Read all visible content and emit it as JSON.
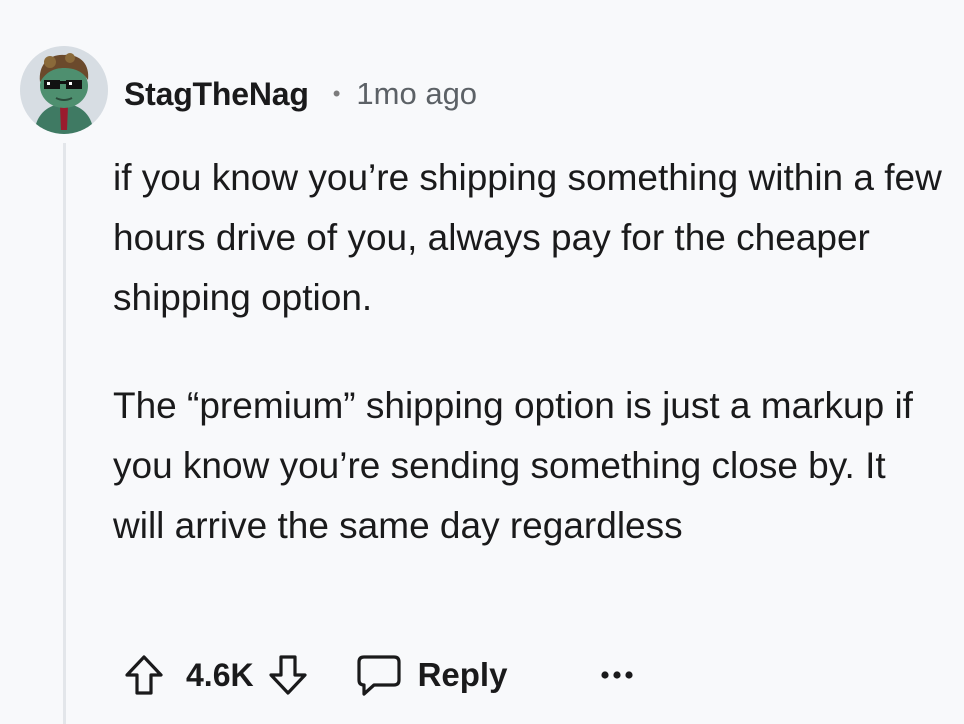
{
  "comment": {
    "username": "StagTheNag",
    "separator": "•",
    "timestamp": "1mo ago",
    "paragraphs": [
      "if you know you’re shipping something within a few hours drive of you, always pay for the cheaper shipping option.",
      "The “premium” shipping option is just a markup if you know you’re sending something close by. It will arrive the same day regardless"
    ]
  },
  "actions": {
    "score": "4.6K",
    "reply_label": "Reply"
  },
  "icons": {
    "upvote": "arrow-up-outline-icon",
    "downvote": "arrow-down-outline-icon",
    "reply": "speech-bubble-icon",
    "more": "ellipsis-icon"
  }
}
